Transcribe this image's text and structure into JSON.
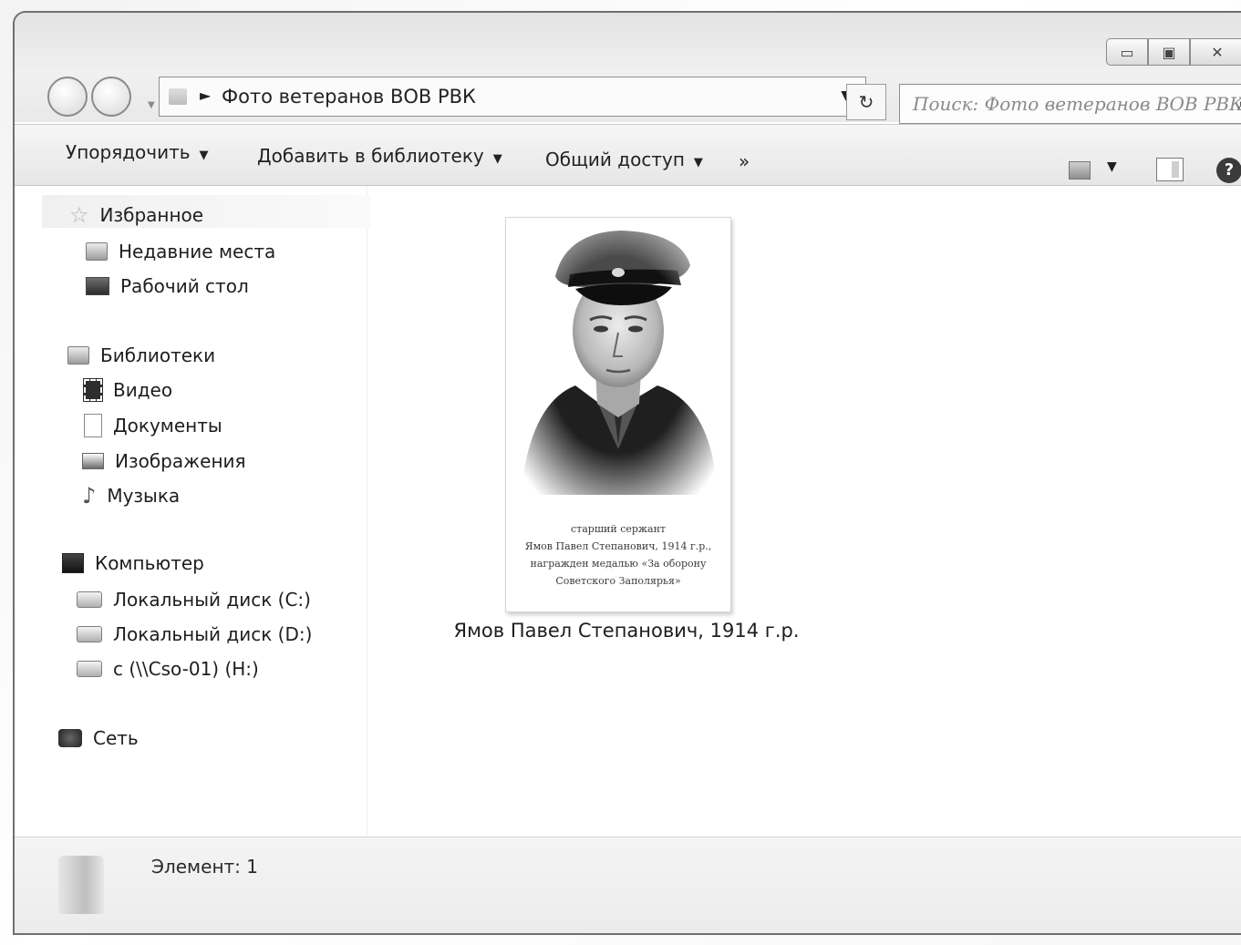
{
  "window": {
    "controls": {
      "minimize": "▭",
      "maximize": "▣",
      "close": "✕"
    }
  },
  "address_bar": {
    "path": "Фото ветеранов ВОВ РВК",
    "separator": "►",
    "dropdown": "▼",
    "refresh": "↻"
  },
  "search": {
    "placeholder": "Поиск: Фото ветеранов ВОВ РВК",
    "icon": "search-icon"
  },
  "toolbar": {
    "organize": "Упорядочить",
    "add_to_library": "Добавить в библиотеку",
    "share": "Общий доступ",
    "more": "»",
    "caret": "▼",
    "help": "?"
  },
  "nav": {
    "favorites": {
      "label": "Избранное",
      "items": [
        "Недавние места",
        "Рабочий стол"
      ]
    },
    "libraries": {
      "label": "Библиотеки",
      "items": [
        "Видео",
        "Документы",
        "Изображения",
        "Музыка"
      ]
    },
    "computer": {
      "label": "Компьютер",
      "items": [
        "Локальный диск (C:)",
        "Локальный диск (D:)",
        "c (\\\\Cso-01) (H:)"
      ]
    },
    "network": {
      "label": "Сеть"
    }
  },
  "content": {
    "file": {
      "name": "Ямов Павел Степанович, 1914 г.р.",
      "caption_lines": [
        "старший сержант",
        "Ямов Павел Степанович, 1914 г.р.,",
        "награжден медалью «За оборону",
        "Советского Заполярья»"
      ]
    }
  },
  "status": {
    "items_text": "Элемент: 1"
  }
}
